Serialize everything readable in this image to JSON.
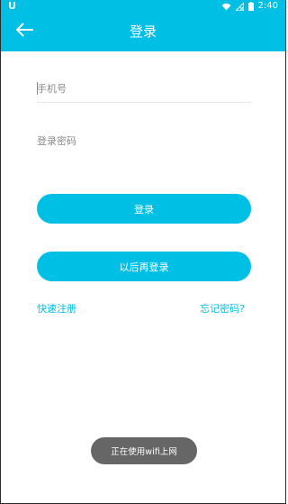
{
  "status_bar": {
    "carrier_glyph": "U",
    "time": "2:40",
    "icons": [
      "wifi-icon",
      "signal-off-icon",
      "battery-icon"
    ]
  },
  "toolbar": {
    "title": "登录",
    "back_icon": "arrow-left-icon"
  },
  "form": {
    "phone_placeholder": "手机号",
    "phone_value": "",
    "password_placeholder": "登录密码",
    "password_value": ""
  },
  "buttons": {
    "login": "登录",
    "login_later": "以后再登录"
  },
  "links": {
    "register": "快速注册",
    "forgot_password": "忘记密码?"
  },
  "toast": {
    "message": "正在使用wifi上网"
  },
  "colors": {
    "accent": "#00bfe5",
    "toast_bg": "#666666",
    "placeholder": "#8a8a8a"
  }
}
